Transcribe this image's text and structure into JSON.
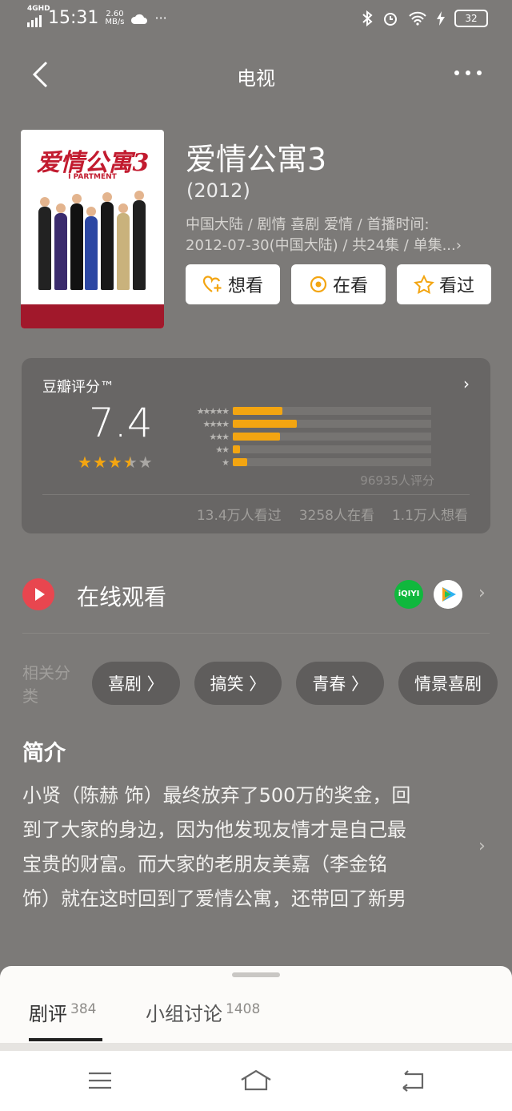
{
  "status": {
    "net": "4GHD",
    "time": "15:31",
    "speed_value": "2.60",
    "speed_unit": "MB/s",
    "battery": "32",
    "more": "···"
  },
  "nav": {
    "title": "电视"
  },
  "poster": {
    "title": "爱情公寓3",
    "subtitle": "I PARTMENT"
  },
  "show": {
    "title": "爱情公寓3",
    "year": "(2012)",
    "meta_line1": "中国大陆 / 剧情 喜剧 爱情 / 首播时间:",
    "meta_line2": "2012-07-30(中国大陆) / 共24集 / 单集...›"
  },
  "actions": [
    {
      "label": "想看",
      "icon": "heart-plus-icon"
    },
    {
      "label": "在看",
      "icon": "target-circle-icon"
    },
    {
      "label": "看过",
      "icon": "star-outline-icon"
    }
  ],
  "rating": {
    "label": "豆瓣评分™",
    "score": "7.4",
    "stars": 3.5,
    "distribution": [
      {
        "stars": "★★★★★",
        "percent": 27
      },
      {
        "stars": "★★★★",
        "percent": 35
      },
      {
        "stars": "★★★",
        "percent": 26
      },
      {
        "stars": "★★",
        "percent": 4
      },
      {
        "stars": "★",
        "percent": 8
      }
    ],
    "count": "96935人评分",
    "seen": "13.4万人看过",
    "watching": "3258人在看",
    "want": "1.1万人想看",
    "accent": "#f3a511"
  },
  "watch": {
    "label": "在线观看",
    "iqiyi": "iQIYI",
    "arrow": "›"
  },
  "tags": {
    "label": "相关分类",
    "items": [
      "喜剧 〉",
      "搞笑 〉",
      "青春 〉",
      "情景喜剧"
    ]
  },
  "synopsis": {
    "heading": "简介",
    "lines": [
      "小贤（陈赫 饰）最终放弃了500万的奖金，回",
      "到了大家的身边，因为他发现友情才是自己最",
      "宝贵的财富。而大家的老朋友美嘉（李金铭",
      "饰）就在这时回到了爱情公寓，还带回了新男"
    ]
  },
  "sheet": {
    "tabs": [
      {
        "label": "剧评",
        "count": "384"
      },
      {
        "label": "小组讨论",
        "count": "1408"
      }
    ]
  }
}
